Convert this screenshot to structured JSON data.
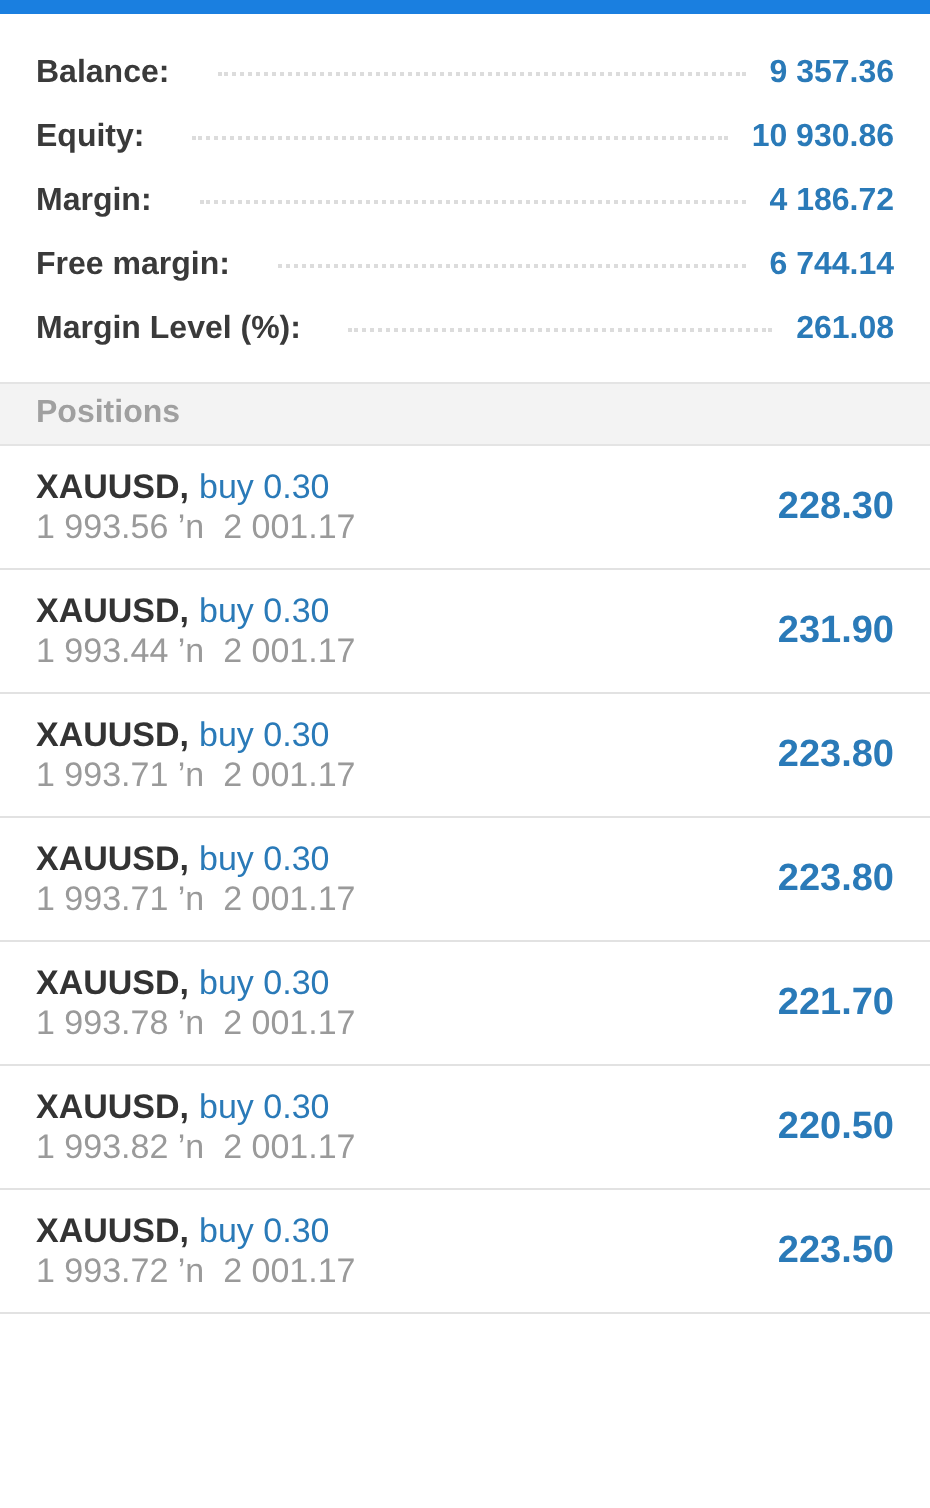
{
  "summary": [
    {
      "label": "Balance:",
      "value": "9 357.36"
    },
    {
      "label": "Equity:",
      "value": "10 930.86"
    },
    {
      "label": "Margin:",
      "value": "4 186.72"
    },
    {
      "label": "Free margin:",
      "value": "6 744.14"
    },
    {
      "label": "Margin Level (%):",
      "value": "261.08"
    }
  ],
  "positions_header": "Positions",
  "positions": [
    {
      "symbol": "XAUUSD,",
      "order": "buy 0.30",
      "prices": "1 993.56 ’n  2 001.17",
      "profit": "228.30"
    },
    {
      "symbol": "XAUUSD,",
      "order": "buy 0.30",
      "prices": "1 993.44 ’n  2 001.17",
      "profit": "231.90"
    },
    {
      "symbol": "XAUUSD,",
      "order": "buy 0.30",
      "prices": "1 993.71 ’n  2 001.17",
      "profit": "223.80"
    },
    {
      "symbol": "XAUUSD,",
      "order": "buy 0.30",
      "prices": "1 993.71 ’n  2 001.17",
      "profit": "223.80"
    },
    {
      "symbol": "XAUUSD,",
      "order": "buy 0.30",
      "prices": "1 993.78 ’n  2 001.17",
      "profit": "221.70"
    },
    {
      "symbol": "XAUUSD,",
      "order": "buy 0.30",
      "prices": "1 993.82 ’n  2 001.17",
      "profit": "220.50"
    },
    {
      "symbol": "XAUUSD,",
      "order": "buy 0.30",
      "prices": "1 993.72 ’n  2 001.17",
      "profit": "223.50"
    }
  ]
}
